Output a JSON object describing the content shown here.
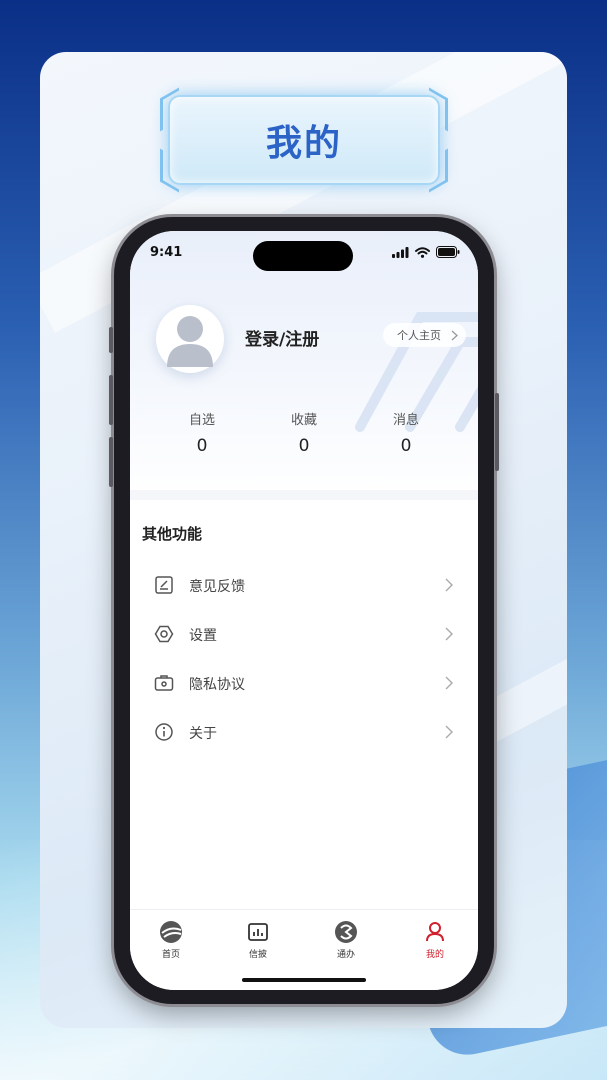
{
  "page_title": "我的",
  "status_bar": {
    "time": "9:41"
  },
  "profile": {
    "login_label": "登录/注册",
    "homepage_label": "个人主页"
  },
  "stats": [
    {
      "label": "自选",
      "value": "0"
    },
    {
      "label": "收藏",
      "value": "0"
    },
    {
      "label": "消息",
      "value": "0"
    }
  ],
  "section": {
    "title": "其他功能"
  },
  "menu": [
    {
      "label": "意见反馈",
      "icon": "feedback-edit-icon"
    },
    {
      "label": "设置",
      "icon": "hexagon-settings-icon"
    },
    {
      "label": "隐私协议",
      "icon": "briefcase-privacy-icon"
    },
    {
      "label": "关于",
      "icon": "info-circle-icon"
    }
  ],
  "tabs": [
    {
      "label": "首页",
      "icon": "home-logo-icon",
      "active": false
    },
    {
      "label": "信披",
      "icon": "chart-board-icon",
      "active": false
    },
    {
      "label": "通办",
      "icon": "swirl-logo-icon",
      "active": false
    },
    {
      "label": "我的",
      "icon": "user-profile-icon",
      "active": true
    }
  ],
  "colors": {
    "accent_red": "#d0202e",
    "title_blue": "#2b63c7",
    "card_bg": "#eef4fb"
  }
}
